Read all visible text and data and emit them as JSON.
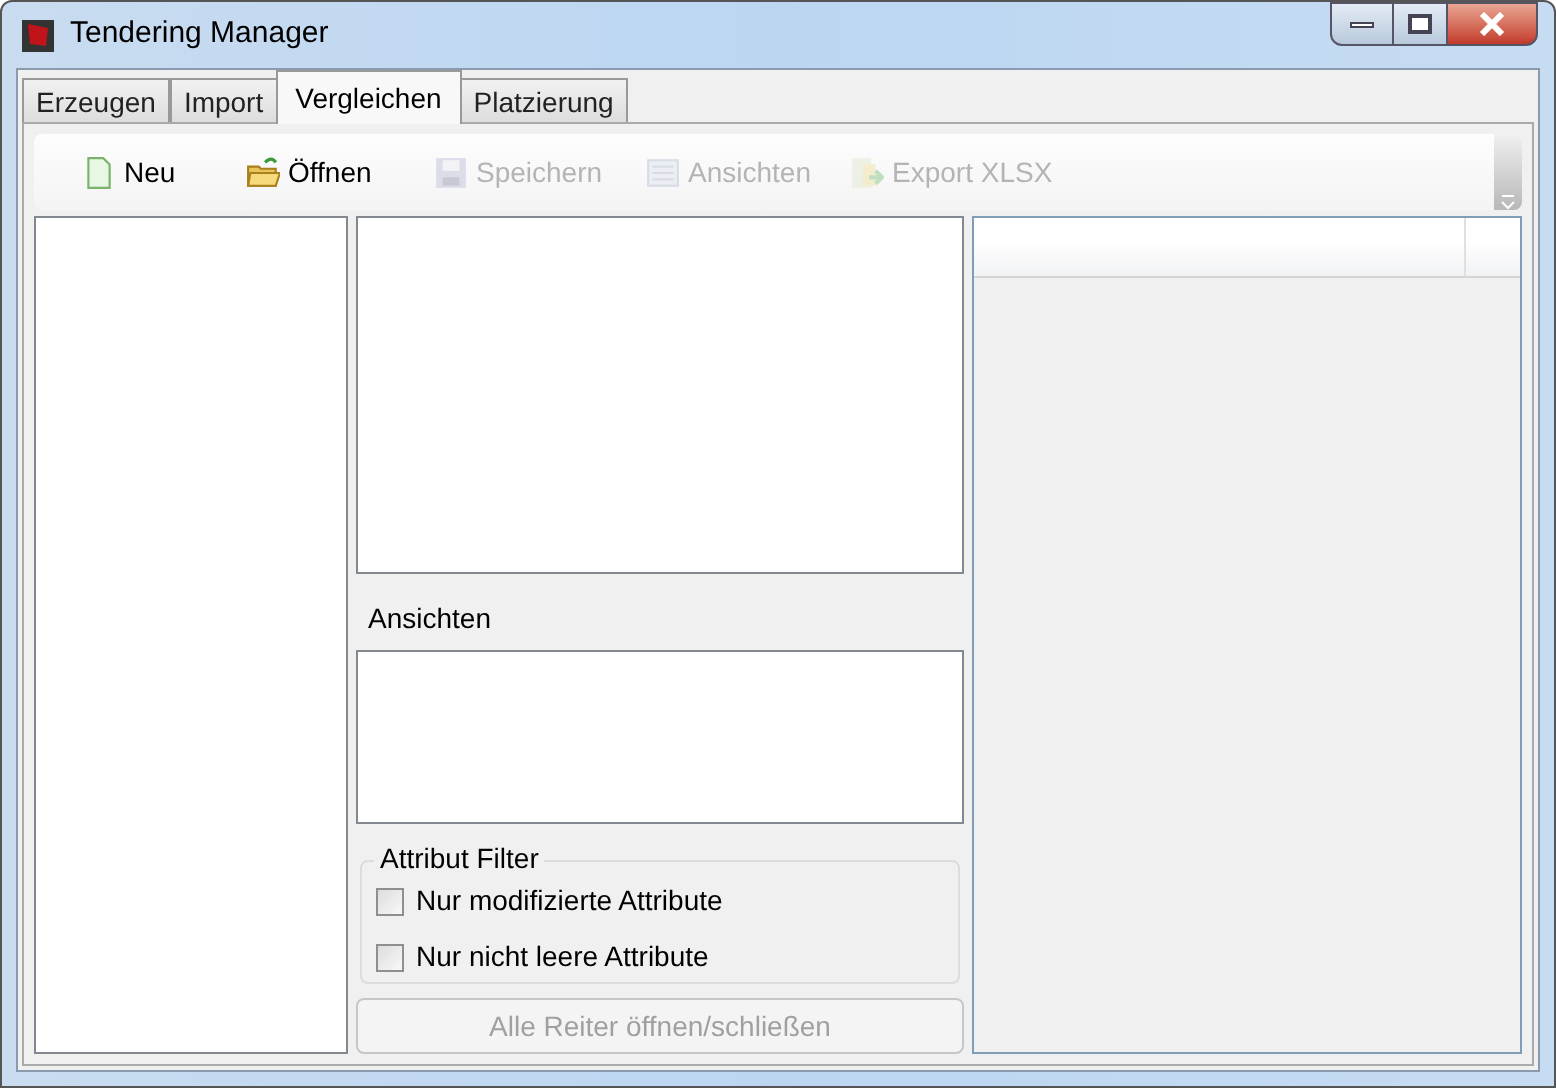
{
  "window": {
    "title": "Tendering Manager"
  },
  "tabs": [
    {
      "label": "Erzeugen",
      "selected": false
    },
    {
      "label": "Import",
      "selected": false
    },
    {
      "label": "Vergleichen",
      "selected": true
    },
    {
      "label": "Platzierung",
      "selected": false
    }
  ],
  "toolbar": [
    {
      "kind": "new",
      "label": "Neu",
      "disabled": false
    },
    {
      "kind": "open",
      "label": "Öffnen",
      "disabled": false
    },
    {
      "kind": "save",
      "label": "Speichern",
      "disabled": true
    },
    {
      "kind": "views",
      "label": "Ansichten",
      "disabled": true
    },
    {
      "kind": "export",
      "label": "Export XLSX",
      "disabled": true
    }
  ],
  "views_label": "Ansichten",
  "attribute_filter": {
    "title": "Attribut Filter",
    "options": [
      {
        "label": "Nur modifizierte Attribute",
        "checked": false
      },
      {
        "label": "Nur nicht leere Attribute",
        "checked": false
      }
    ]
  },
  "toggle_button": {
    "label": "Alle Reiter öffnen/schließen",
    "disabled": true
  }
}
